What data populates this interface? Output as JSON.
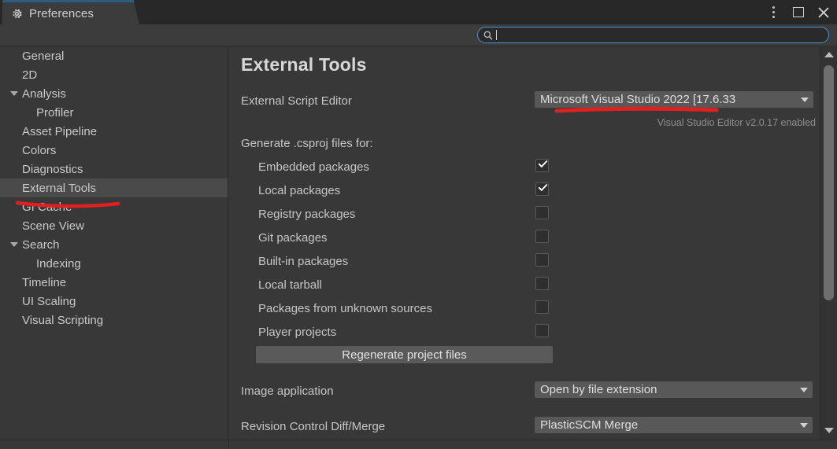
{
  "window": {
    "tab_label": "Preferences",
    "tab_icon": "gear-icon",
    "controls": {
      "menu": "kebab-menu-icon",
      "maximize": "maximize-icon",
      "close": "close-icon"
    },
    "accent_color": "#2c5d87"
  },
  "search": {
    "icon": "search-icon",
    "value": "",
    "placeholder": "",
    "focused": true,
    "border_color": "#4a90d9"
  },
  "sidebar": {
    "items": [
      {
        "label": "General",
        "level": 0,
        "expandable": false,
        "selected": false
      },
      {
        "label": "2D",
        "level": 0,
        "expandable": false,
        "selected": false
      },
      {
        "label": "Analysis",
        "level": 0,
        "expandable": true,
        "selected": false
      },
      {
        "label": "Profiler",
        "level": 1,
        "expandable": false,
        "selected": false
      },
      {
        "label": "Asset Pipeline",
        "level": 0,
        "expandable": false,
        "selected": false
      },
      {
        "label": "Colors",
        "level": 0,
        "expandable": false,
        "selected": false
      },
      {
        "label": "Diagnostics",
        "level": 0,
        "expandable": false,
        "selected": false
      },
      {
        "label": "External Tools",
        "level": 0,
        "expandable": false,
        "selected": true
      },
      {
        "label": "GI Cache",
        "level": 0,
        "expandable": false,
        "selected": false
      },
      {
        "label": "Scene View",
        "level": 0,
        "expandable": false,
        "selected": false
      },
      {
        "label": "Search",
        "level": 0,
        "expandable": true,
        "selected": false
      },
      {
        "label": "Indexing",
        "level": 1,
        "expandable": false,
        "selected": false
      },
      {
        "label": "Timeline",
        "level": 0,
        "expandable": false,
        "selected": false
      },
      {
        "label": "UI Scaling",
        "level": 0,
        "expandable": false,
        "selected": false
      },
      {
        "label": "Visual Scripting",
        "level": 0,
        "expandable": false,
        "selected": false
      }
    ]
  },
  "main": {
    "title": "External Tools",
    "script_editor": {
      "label": "External Script Editor",
      "value": "Microsoft Visual Studio 2022 [17.6.33",
      "hint": "Visual Studio Editor v2.0.17 enabled"
    },
    "csproj": {
      "group_label": "Generate .csproj files for:",
      "options": [
        {
          "label": "Embedded packages",
          "checked": true
        },
        {
          "label": "Local packages",
          "checked": true
        },
        {
          "label": "Registry packages",
          "checked": false
        },
        {
          "label": "Git packages",
          "checked": false
        },
        {
          "label": "Built-in packages",
          "checked": false
        },
        {
          "label": "Local tarball",
          "checked": false
        },
        {
          "label": "Packages from unknown sources",
          "checked": false
        },
        {
          "label": "Player projects",
          "checked": false
        }
      ]
    },
    "regenerate_button": "Regenerate project files",
    "image_application": {
      "label": "Image application",
      "value": "Open by file extension"
    },
    "revision_control": {
      "label": "Revision Control Diff/Merge",
      "value": "PlasticSCM Merge"
    }
  },
  "scrollbar": {
    "up_arrow": "scroll-up-arrow-icon",
    "down_arrow": "scroll-down-arrow-icon"
  },
  "annotations": {
    "color": "#e01f1f",
    "marks": [
      {
        "name": "underline-external-tools"
      },
      {
        "name": "underline-script-editor-value"
      }
    ]
  }
}
